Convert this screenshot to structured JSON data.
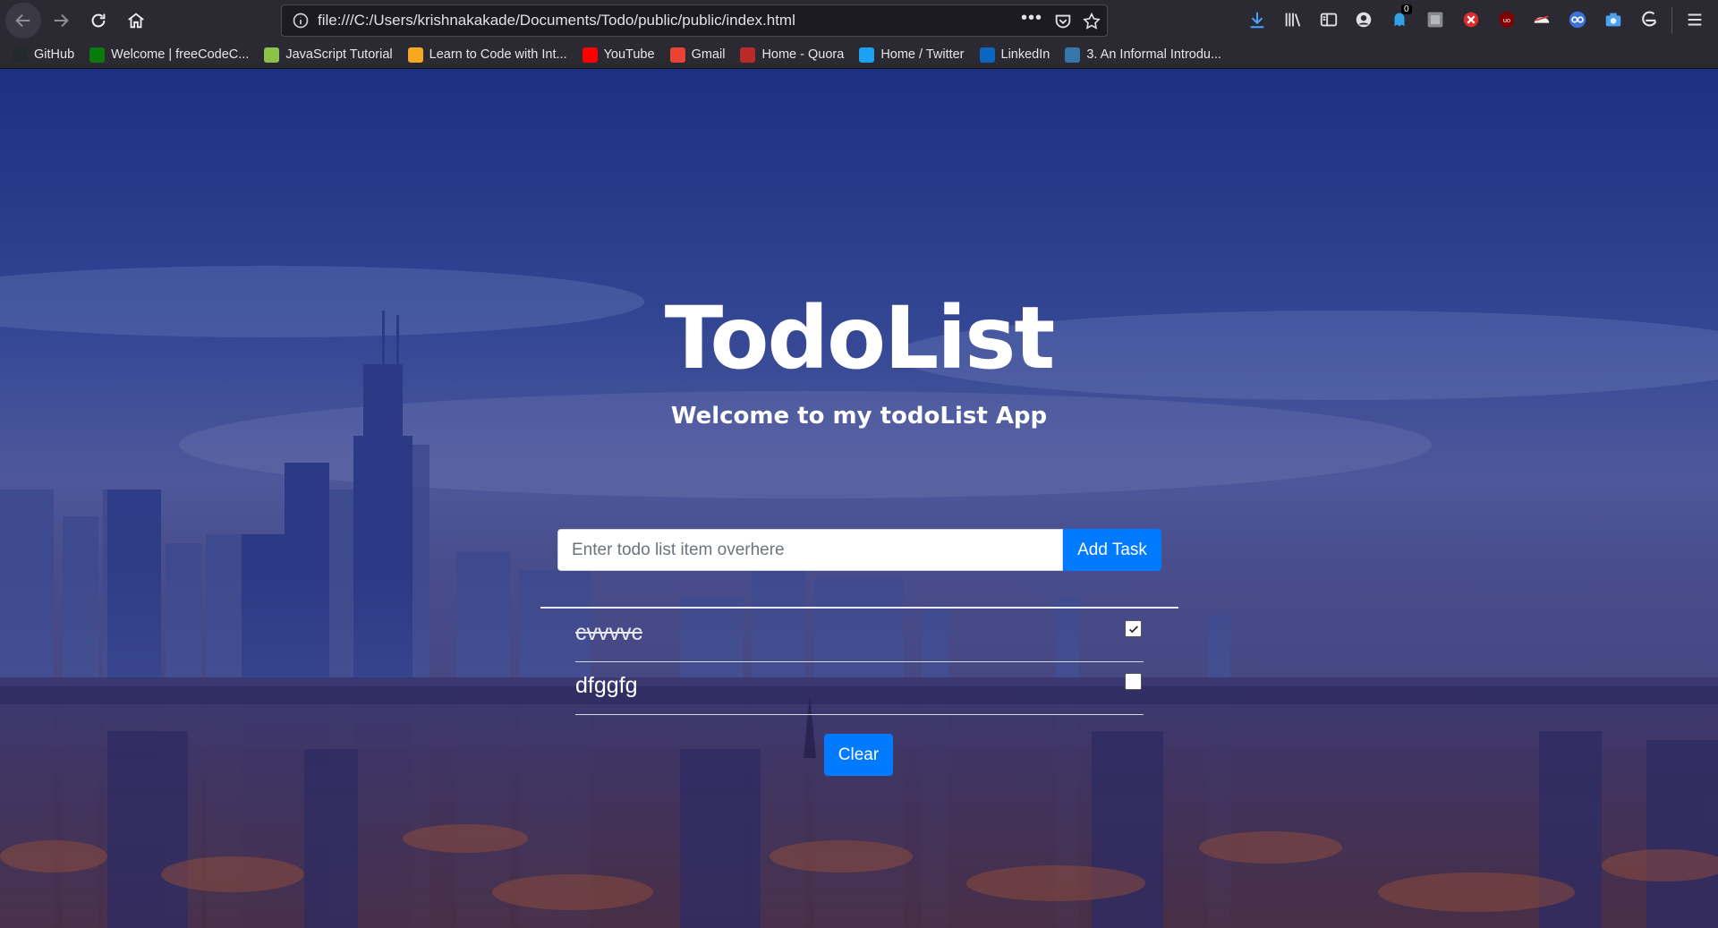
{
  "browser": {
    "url": "file:///C:/Users/krishnakakade/Documents/Todo/public/public/index.html",
    "notification_count": "0",
    "bookmarks": [
      {
        "label": "GitHub",
        "icon": "github-icon",
        "color": "#24292e"
      },
      {
        "label": "Welcome | freeCodeC...",
        "icon": "freecodecamp-icon",
        "color": "#0a7a0a"
      },
      {
        "label": "JavaScript Tutorial",
        "icon": "javascript-tutorial-icon",
        "color": "#8bc34a"
      },
      {
        "label": "Learn to Code with Int...",
        "icon": "codecademy-icon",
        "color": "#f7a823"
      },
      {
        "label": "YouTube",
        "icon": "youtube-icon",
        "color": "#ff0000"
      },
      {
        "label": "Gmail",
        "icon": "gmail-icon",
        "color": "#ea4335"
      },
      {
        "label": "Home - Quora",
        "icon": "quora-icon",
        "color": "#b92b27"
      },
      {
        "label": "Home / Twitter",
        "icon": "twitter-icon",
        "color": "#1da1f2"
      },
      {
        "label": "LinkedIn",
        "icon": "linkedin-icon",
        "color": "#0a66c2"
      },
      {
        "label": "3. An Informal Introdu...",
        "icon": "python-icon",
        "color": "#3776ab"
      }
    ]
  },
  "app": {
    "title": "TodoList",
    "subtitle": "Welcome to my todoList App",
    "input_placeholder": "Enter todo list item overhere",
    "input_value": "",
    "add_label": "Add Task",
    "clear_label": "Clear",
    "accent": "#007bff"
  },
  "todos": [
    {
      "text": "cvvvvc",
      "completed": true
    },
    {
      "text": "dfggfg",
      "completed": false
    }
  ]
}
